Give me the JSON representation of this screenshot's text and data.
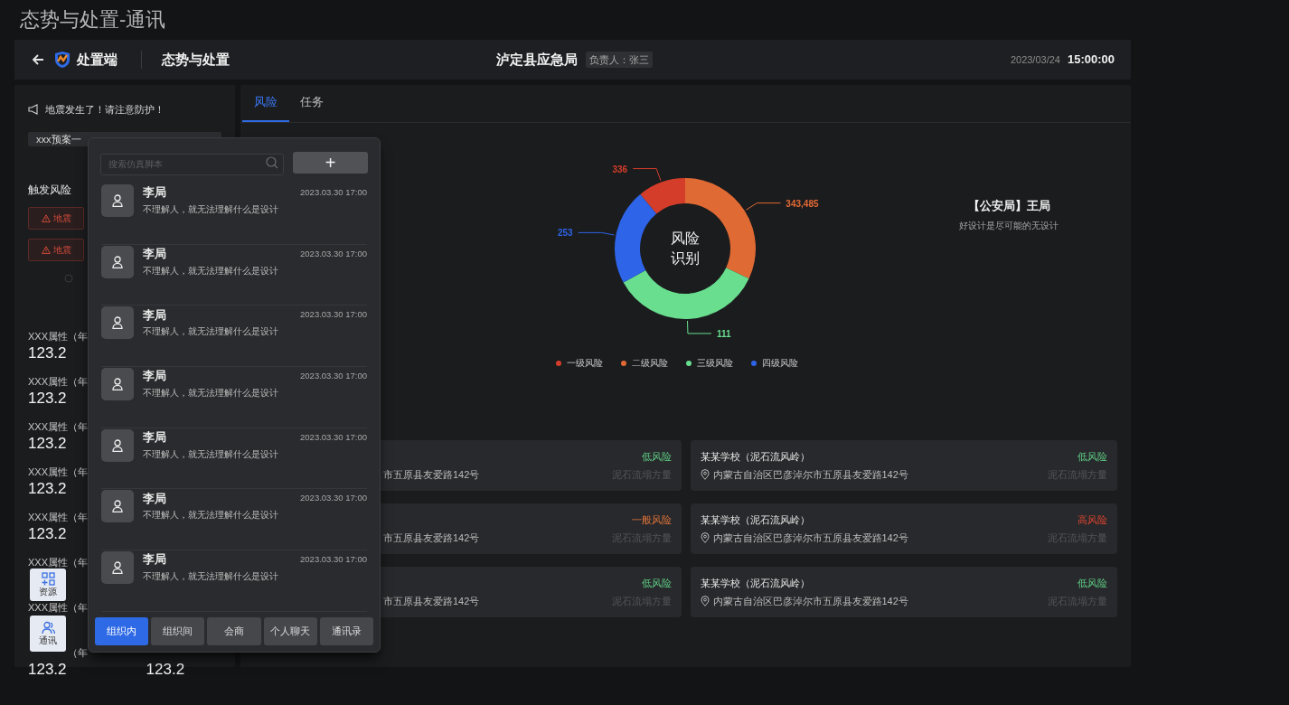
{
  "page_title": "态势与处置-通讯",
  "header": {
    "app_name": "处置端",
    "section": "态势与处置",
    "agency": "泸定县应急局",
    "owner": "负责人：张三",
    "date": "2023/03/24",
    "time": "15:00:00"
  },
  "left_panel": {
    "notice": "地震发生了！请注意防护！",
    "plan_select": "xxx预案一",
    "trigger_title": "触发风险",
    "trigger_tags": [
      "地震",
      "地震"
    ],
    "attributes": [
      {
        "label": "XXX属性（年",
        "value": "123.2"
      },
      {
        "label": "XXX属性（年",
        "value": "123.2"
      },
      {
        "label": "XXX属性（年",
        "value": "123.2"
      },
      {
        "label": "XXX属性（年",
        "value": "123.2"
      },
      {
        "label": "XXX属性（年",
        "value": "123.2"
      },
      {
        "label": "XXX属性（年"
      },
      {
        "label": "XXX属性（年"
      },
      {
        "label": "（年",
        "value": "123.2",
        "value_2": "123.2"
      }
    ]
  },
  "tabs": [
    {
      "label": "风险",
      "selected": true
    },
    {
      "label": "任务",
      "selected": false
    }
  ],
  "risk_ring": {
    "center_label": "风险识别",
    "slices": [
      {
        "name": "一级风险",
        "color": "#d43d2a",
        "reading": "336"
      },
      {
        "name": "二级风险",
        "color": "#e06a34",
        "reading": "343,485"
      },
      {
        "name": "三级风险",
        "color": "#68de8e",
        "reading": "111"
      },
      {
        "name": "四级风险",
        "color": "#2e64e8",
        "reading": "253"
      }
    ]
  },
  "contact": {
    "name": "【公安局】王局",
    "motto": "好设计是尽可能的无设计"
  },
  "sites": [
    {
      "address": "市五原县友爱路142号",
      "risk": "低风险",
      "kind": "low",
      "metric": "泥石流塌方量"
    },
    {
      "title": "某某学校（泥石流风岭）",
      "address": "内蒙古自治区巴彦淖尔市五原县友爱路142号",
      "risk": "低风险",
      "kind": "low",
      "metric": "泥石流塌方量"
    },
    {
      "address": "市五原县友爱路142号",
      "risk": "一般风险",
      "kind": "medium",
      "metric": "泥石流塌方量"
    },
    {
      "title": "某某学校（泥石流风岭）",
      "address": "内蒙古自治区巴彦淖尔市五原县友爱路142号",
      "risk": "高风险",
      "kind": "high",
      "metric": "泥石流塌方量"
    },
    {
      "address": "市五原县友爱路142号",
      "risk": "低风险",
      "kind": "low",
      "metric": "泥石流塌方量"
    },
    {
      "title": "某某学校（泥石流风岭）",
      "address": "内蒙古自治区巴彦淖尔市五原县友爱路142号",
      "risk": "低风险",
      "kind": "low",
      "metric": "泥石流塌方量"
    }
  ],
  "dock": [
    {
      "kind": "resources",
      "label": "资源"
    },
    {
      "kind": "comms",
      "label": "通讯"
    }
  ],
  "chat_popup": {
    "search": {
      "placeholder": "搜索仿真脚本"
    },
    "add_button": "+",
    "messages": [
      {
        "name": "李局",
        "time": "2023.03.30 17:00",
        "text": "不理解人，就无法理解什么是设计"
      },
      {
        "name": "李局",
        "time": "2023.03.30 17:00",
        "text": "不理解人，就无法理解什么是设计"
      },
      {
        "name": "李局",
        "time": "2023.03.30 17:00",
        "text": "不理解人，就无法理解什么是设计"
      },
      {
        "name": "李局",
        "time": "2023.03.30 17:00",
        "text": "不理解人，就无法理解什么是设计"
      },
      {
        "name": "李局",
        "time": "2023.03.30 17:00",
        "text": "不理解人，就无法理解什么是设计"
      },
      {
        "name": "李局",
        "time": "2023.03.30 17:00",
        "text": "不理解人，就无法理解什么是设计"
      },
      {
        "name": "李局",
        "time": "2023.03.30 17:00",
        "text": "不理解人，就无法理解什么是设计"
      }
    ],
    "tabs": [
      {
        "label": "组织内",
        "selected": true
      },
      {
        "label": "组织间",
        "selected": false
      },
      {
        "label": "会商",
        "selected": false
      },
      {
        "label": "个人聊天",
        "selected": false
      },
      {
        "label": "通讯录",
        "selected": false
      }
    ]
  }
}
